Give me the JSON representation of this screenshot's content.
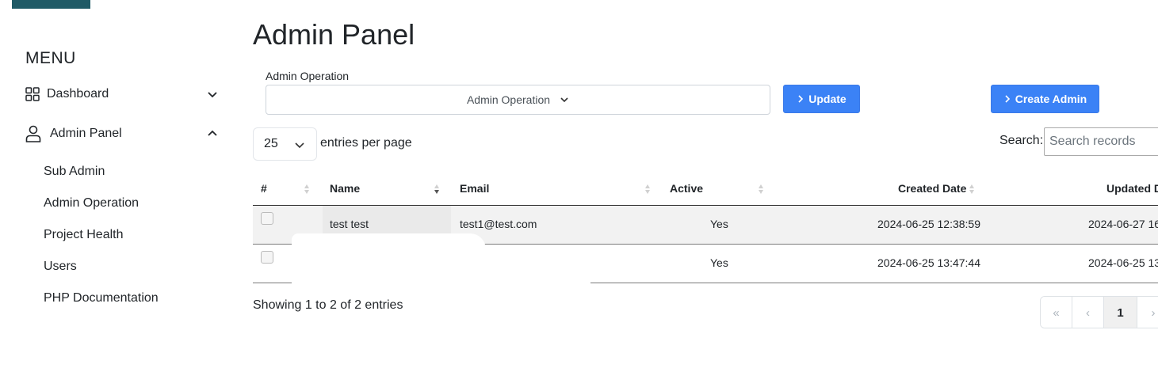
{
  "sidebar": {
    "menu_title": "MENU",
    "items": [
      {
        "label": "Dashboard",
        "icon": "grid-icon",
        "expanded": false
      },
      {
        "label": "Admin Panel",
        "icon": "user-icon",
        "expanded": true
      }
    ],
    "sub_items": [
      "Sub Admin",
      "Admin Operation",
      "Project Health",
      "Users",
      "PHP Documentation"
    ]
  },
  "main": {
    "title": "Admin Panel",
    "operation": {
      "label": "Admin Operation",
      "selected": "Admin Operation"
    },
    "update_label": "Update",
    "create_label": "Create Admin",
    "length": {
      "value": "25",
      "suffix": "entries per page"
    },
    "search": {
      "label": "Search:",
      "placeholder": "Search records"
    },
    "table": {
      "columns": [
        "#",
        "Name",
        "Email",
        "Active",
        "Created Date",
        "Updated D"
      ],
      "rows": [
        {
          "name": "test test",
          "email": "test1@test.com",
          "active": "Yes",
          "created": "2024-06-25 12:38:59",
          "updated": "2024-06-27 16"
        },
        {
          "name": "",
          "email": "",
          "active": "Yes",
          "created": "2024-06-25 13:47:44",
          "updated": "2024-06-25 13"
        }
      ]
    },
    "info": "Showing 1 to 2 of 2 entries",
    "pagination": {
      "first": "«",
      "prev": "‹",
      "current": "1",
      "next": "›"
    }
  },
  "colors": {
    "primary": "#3b82f6",
    "logo": "#1f5a66"
  }
}
